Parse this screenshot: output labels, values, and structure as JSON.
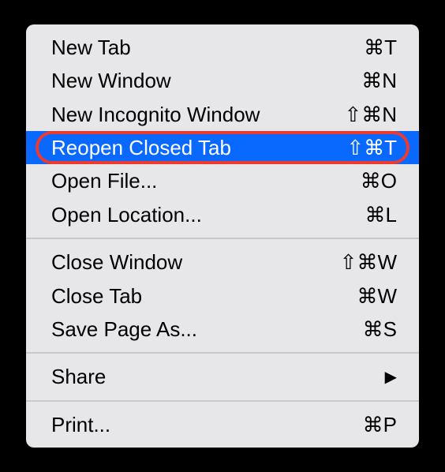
{
  "menu": {
    "groups": [
      [
        {
          "label": "New Tab",
          "shortcut": "⌘T",
          "highlighted": false
        },
        {
          "label": "New Window",
          "shortcut": "⌘N",
          "highlighted": false
        },
        {
          "label": "New Incognito Window",
          "shortcut": "⇧⌘N",
          "highlighted": false
        },
        {
          "label": "Reopen Closed Tab",
          "shortcut": "⇧⌘T",
          "highlighted": true,
          "ring": true
        },
        {
          "label": "Open File...",
          "shortcut": "⌘O",
          "highlighted": false
        },
        {
          "label": "Open Location...",
          "shortcut": "⌘L",
          "highlighted": false
        }
      ],
      [
        {
          "label": "Close Window",
          "shortcut": "⇧⌘W",
          "highlighted": false
        },
        {
          "label": "Close Tab",
          "shortcut": "⌘W",
          "highlighted": false
        },
        {
          "label": "Save Page As...",
          "shortcut": "⌘S",
          "highlighted": false
        }
      ],
      [
        {
          "label": "Share",
          "shortcut": "",
          "submenu": true,
          "highlighted": false
        }
      ],
      [
        {
          "label": "Print...",
          "shortcut": "⌘P",
          "highlighted": false
        }
      ]
    ]
  }
}
